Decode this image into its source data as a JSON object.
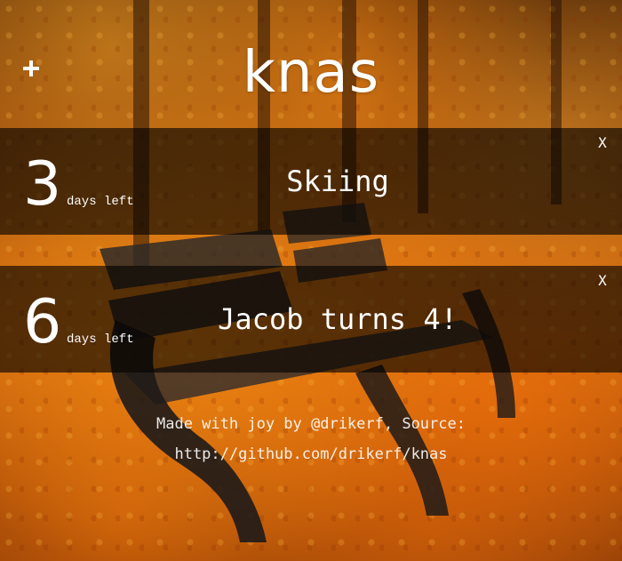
{
  "app": {
    "title": "knas"
  },
  "header": {
    "add_button_icon": "plus-icon"
  },
  "events": [
    {
      "days": "3",
      "days_label": "days left",
      "name": "Skiing",
      "delete_label": "X"
    },
    {
      "days": "6",
      "days_label": "days left",
      "name": "Jacob turns 4!",
      "delete_label": "X"
    }
  ],
  "footer": {
    "line1": "Made with joy by @drikerf, Source:",
    "link": "http://github.com/drikerf/knas"
  },
  "colors": {
    "text": "#ffffff",
    "row_overlay": "rgba(0,0,0,0.62)",
    "background_accent": "#c96a12"
  }
}
